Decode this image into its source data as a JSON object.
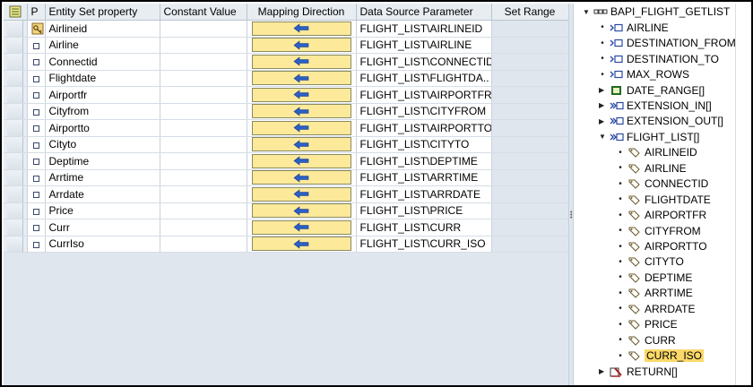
{
  "table": {
    "headers": {
      "p": "P",
      "property": "Entity Set property",
      "constant": "Constant Value",
      "mapping": "Mapping Direction",
      "source": "Data Source Parameter",
      "range": "Set Range"
    },
    "rows": [
      {
        "property": "Airlineid",
        "source": "FLIGHT_LIST\\AIRLINEID",
        "key": true
      },
      {
        "property": "Airline",
        "source": "FLIGHT_LIST\\AIRLINE"
      },
      {
        "property": "Connectid",
        "source": "FLIGHT_LIST\\CONNECTID"
      },
      {
        "property": "Flightdate",
        "source": "FLIGHT_LIST\\FLIGHTDA.."
      },
      {
        "property": "Airportfr",
        "source": "FLIGHT_LIST\\AIRPORTFR"
      },
      {
        "property": "Cityfrom",
        "source": "FLIGHT_LIST\\CITYFROM"
      },
      {
        "property": "Airportto",
        "source": "FLIGHT_LIST\\AIRPORTTO"
      },
      {
        "property": "Cityto",
        "source": "FLIGHT_LIST\\CITYTO"
      },
      {
        "property": "Deptime",
        "source": "FLIGHT_LIST\\DEPTIME"
      },
      {
        "property": "Arrtime",
        "source": "FLIGHT_LIST\\ARRTIME"
      },
      {
        "property": "Arrdate",
        "source": "FLIGHT_LIST\\ARRDATE"
      },
      {
        "property": "Price",
        "source": "FLIGHT_LIST\\PRICE"
      },
      {
        "property": "Curr",
        "source": "FLIGHT_LIST\\CURR"
      },
      {
        "property": "CurrIso",
        "source": "FLIGHT_LIST\\CURR_ISO"
      }
    ],
    "mapping_icon": "arrow-left-icon"
  },
  "tree": {
    "root": "BAPI_FLIGHT_GETLIST",
    "params": [
      {
        "label": "AIRLINE",
        "kind": "import"
      },
      {
        "label": "DESTINATION_FROM",
        "kind": "import"
      },
      {
        "label": "DESTINATION_TO",
        "kind": "import"
      },
      {
        "label": "MAX_ROWS",
        "kind": "import"
      },
      {
        "label": "DATE_RANGE[]",
        "kind": "table-collapsed"
      },
      {
        "label": "EXTENSION_IN[]",
        "kind": "table-collapsed"
      },
      {
        "label": "EXTENSION_OUT[]",
        "kind": "table-collapsed"
      },
      {
        "label": "FLIGHT_LIST[]",
        "kind": "table-expanded"
      }
    ],
    "flight_list_fields": [
      "AIRLINEID",
      "AIRLINE",
      "CONNECTID",
      "FLIGHTDATE",
      "AIRPORTFR",
      "CITYFROM",
      "AIRPORTTO",
      "CITYTO",
      "DEPTIME",
      "ARRTIME",
      "ARRDATE",
      "PRICE",
      "CURR",
      "CURR_ISO"
    ],
    "selected_field": "CURR_ISO",
    "return_label": "RETURN[]"
  },
  "colors": {
    "mapping_button": "#fce99a",
    "selected_highlight": "#fbd869",
    "grid_background": "#dfe6ee"
  }
}
